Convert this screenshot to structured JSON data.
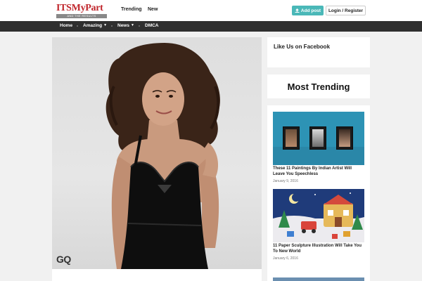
{
  "header": {
    "logo_main": "ITSMy",
    "logo_part": "Part",
    "logo_tagline": "AND THE RESULTS",
    "nav_trending": "Trending",
    "nav_new": "New",
    "add_post_label": "Add post",
    "login_label": "Login / Register"
  },
  "menu": {
    "items": [
      {
        "label": "Home"
      },
      {
        "label": "Amazing"
      },
      {
        "label": "News"
      },
      {
        "label": "DMCA"
      }
    ]
  },
  "hero": {
    "watermark": "GQ"
  },
  "sidebar": {
    "facebook_title": "Like Us on Facebook",
    "trending_title": "Most Trending",
    "posts": [
      {
        "title": "These 11 Paintings By Indian Artist Will Leave You Speechless",
        "date": "January 9, 2016"
      },
      {
        "title": "11 Paper Sculpture Illustration Will Take You To New World",
        "date": "January 6, 2016"
      }
    ]
  },
  "colors": {
    "accent_teal": "#4ab8b8",
    "nav_dark": "#2f2f2f",
    "logo_red": "#c0262c"
  }
}
